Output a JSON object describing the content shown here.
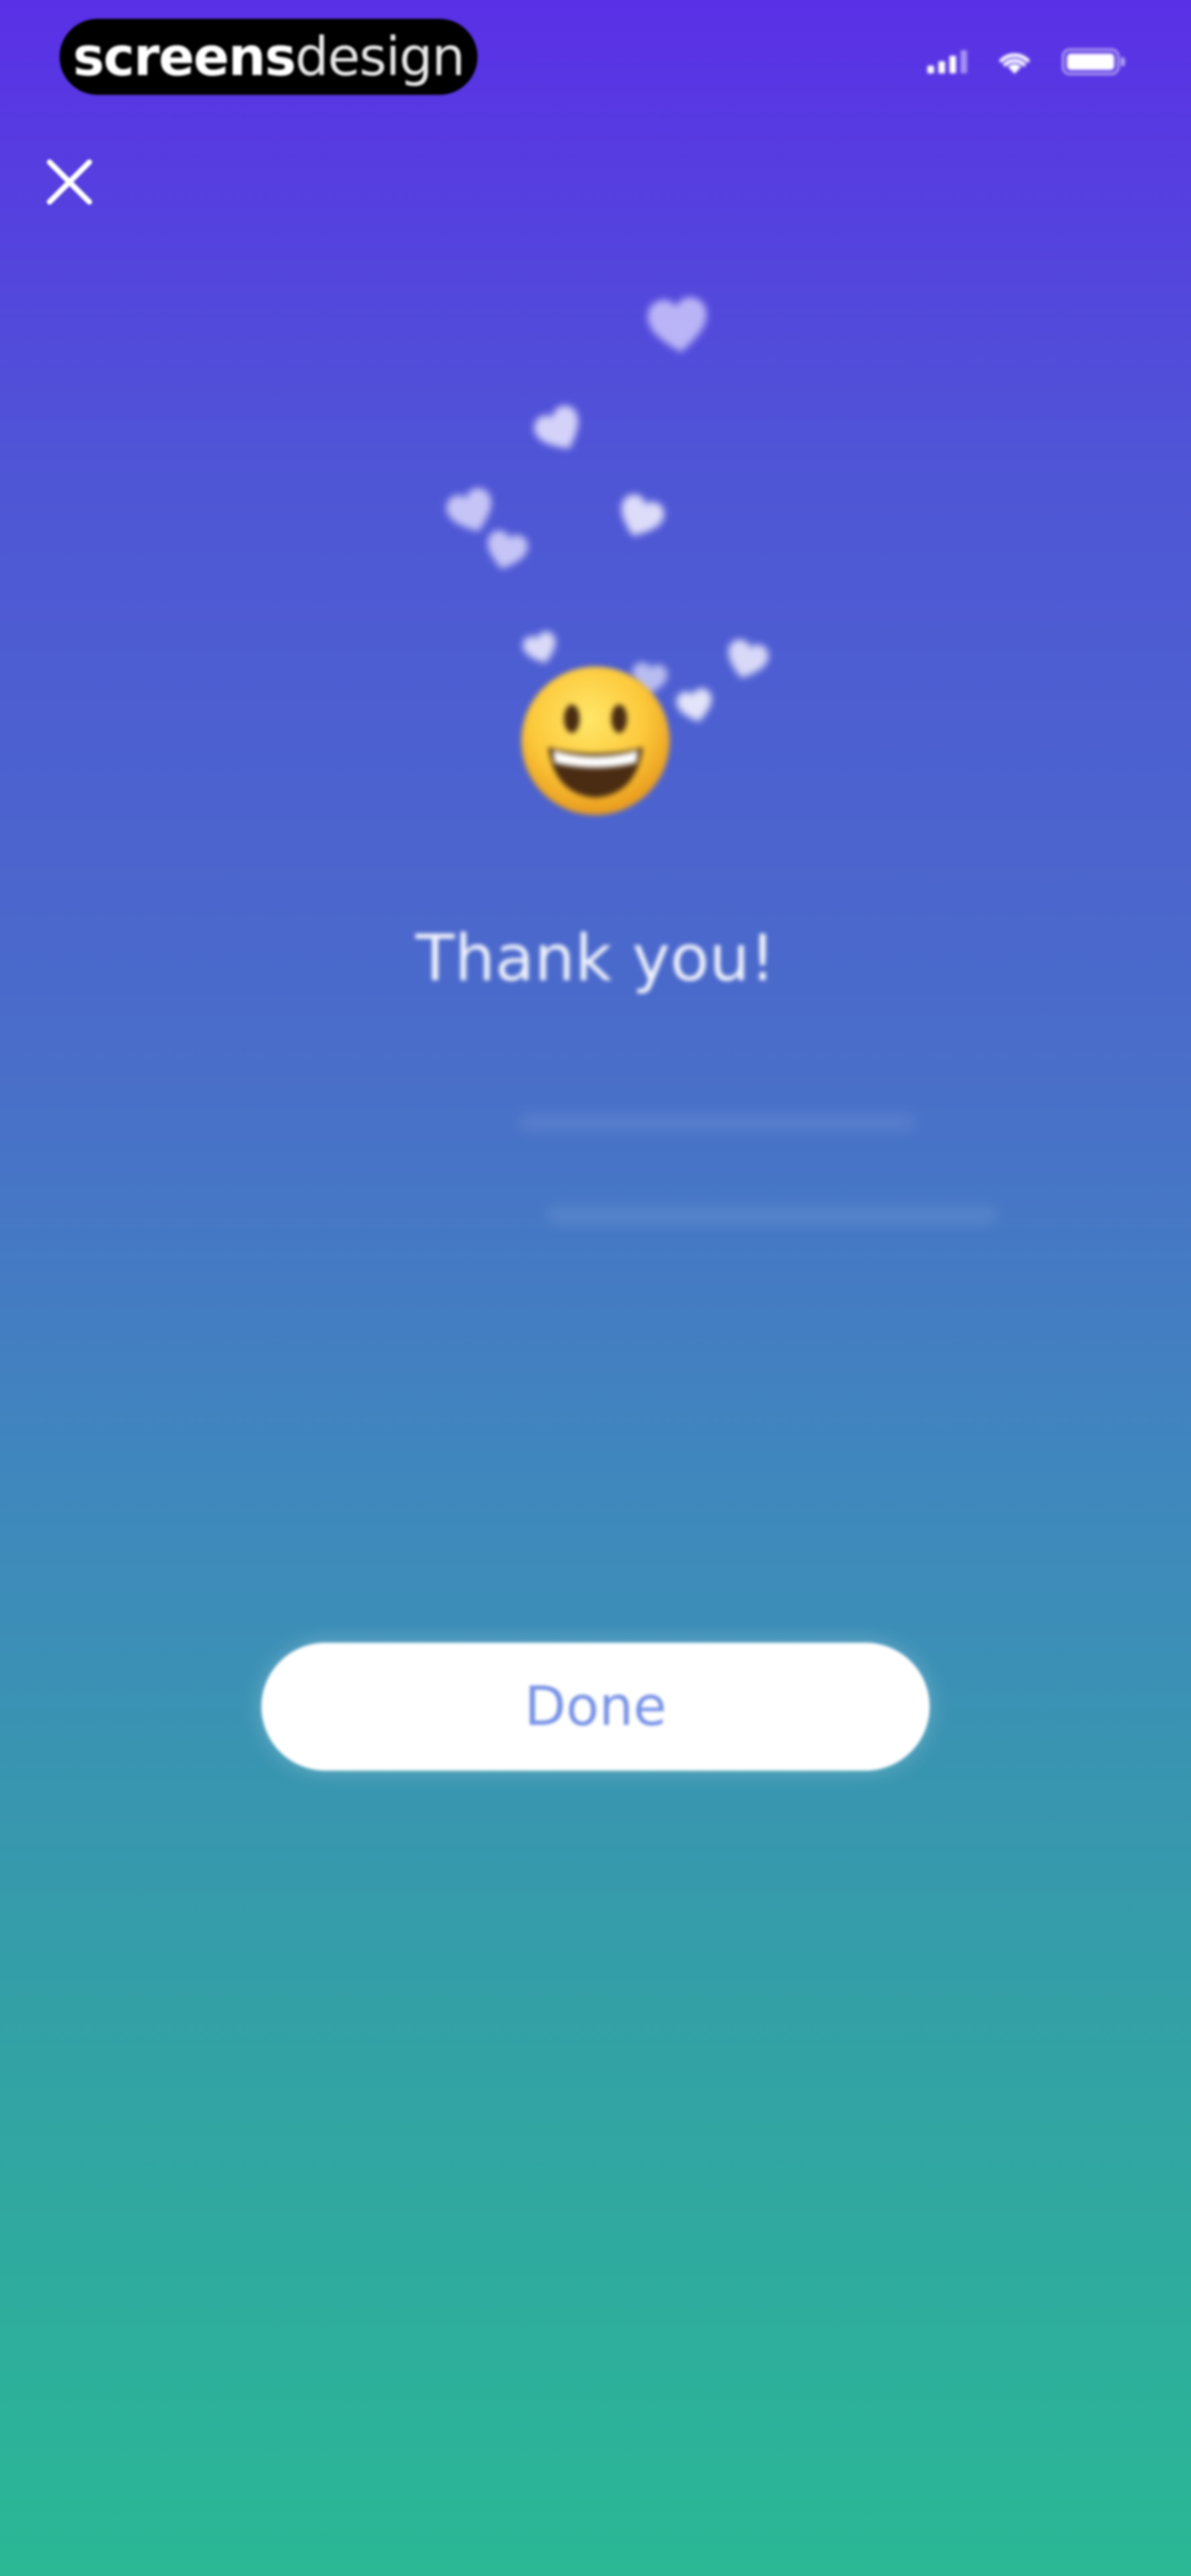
{
  "status_bar": {
    "brand_bold": "screens",
    "brand_light": "design",
    "icons": [
      "signal-icon",
      "wifi-icon",
      "battery-icon"
    ]
  },
  "close": {
    "icon": "close-icon"
  },
  "main": {
    "emoji_icon": "grinning-face-icon",
    "title": "Thank you!"
  },
  "actions": {
    "done_label": "Done"
  },
  "colors": {
    "gradient_top": "#5a30e6",
    "gradient_middle": "#4a6cca",
    "gradient_bottom": "#2ab895",
    "button_bg": "#ffffff",
    "button_text": "#7893e6"
  }
}
